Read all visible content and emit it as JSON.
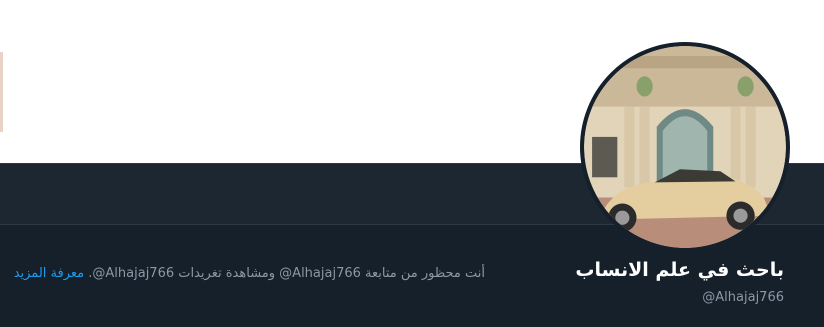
{
  "profile": {
    "display_name": "باحث في علم الانساب",
    "handle": "@Alhajaj766"
  },
  "notice": {
    "text": "أنت محظور من متابعة Alhajaj766@ ومشاهدة تغريدات Alhajaj766@.",
    "learn_more": "معرفة المزيد"
  },
  "colors": {
    "background": "#15202b",
    "header_bar": "#1c2732",
    "link": "#1d9bf0",
    "secondary_text": "#8b98a5"
  }
}
